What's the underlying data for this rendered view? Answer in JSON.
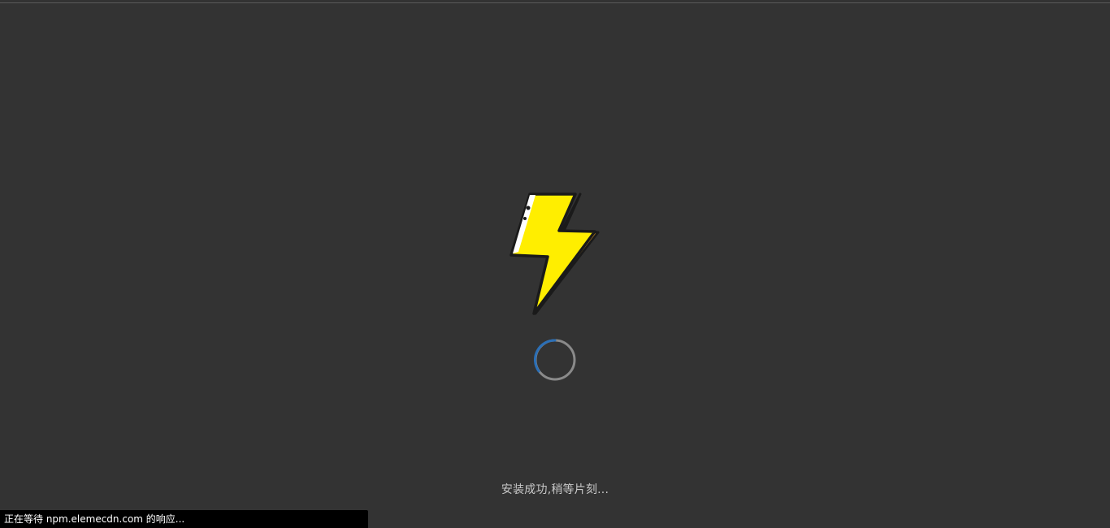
{
  "loading": {
    "logo_icon": "lightning-bolt-icon",
    "spinner_icon": "loading-spinner-icon",
    "message": "安装成功,稍等片刻..."
  },
  "status_bar": {
    "text": "正在等待 npm.elemecdn.com 的响应..."
  },
  "colors": {
    "background": "#333333",
    "bolt_fill": "#FFEE00",
    "bolt_shadow": "#F5A623",
    "bolt_outline": "#1A1A1A",
    "spinner_track": "#8A8A8A",
    "spinner_arc": "#2B6FB6",
    "status_bar_bg": "#000000"
  }
}
